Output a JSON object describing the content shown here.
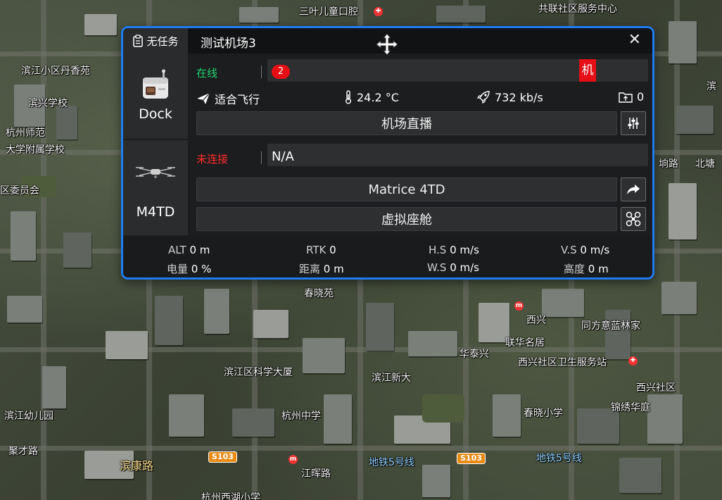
{
  "panel": {
    "task_status": "无任务",
    "title": "测试机场3"
  },
  "dock": {
    "label": "Dock",
    "status": "在线",
    "alert_count": "2",
    "alert_tag": "机",
    "weather": "适合飞行",
    "temperature": "24.2 °C",
    "speed": "732 kb/s",
    "files": "0",
    "live_label": "机场直播"
  },
  "drone": {
    "label": "M4TD",
    "status": "未连接",
    "value": "N/A",
    "model_label": "Matrice 4TD",
    "cockpit_label": "虚拟座舱"
  },
  "telemetry": {
    "alt_label": "ALT",
    "alt": "0 m",
    "rtk_label": "RTK",
    "rtk": "0",
    "hs_label": "H.S",
    "hs": "0 m/s",
    "vs_label": "V.S",
    "vs": "0 m/s",
    "battery_label": "电量",
    "battery": "0 %",
    "distance_label": "距离",
    "distance": "0 m",
    "ws_label": "W.S",
    "ws": "0 m/s",
    "height_label": "高度",
    "height": "0 m"
  },
  "map": {
    "labels": [
      "三叶儿童口腔",
      "共联社区服务中心",
      "滨江小区丹香苑",
      "滨兴学校",
      "杭州师范",
      "大学附属学校",
      "区委员会",
      "垧路",
      "北塘",
      "滨",
      "春晓苑",
      "西兴",
      "同方意蓝林家",
      "联华名居",
      "西兴社区卫生服务站",
      "滨江区科学大厦",
      "滨江新大",
      "华泰兴",
      "杭州中学",
      "滨江幼儿园",
      "春晓小学",
      "西兴社区",
      "锦绣华庭",
      "聚才路",
      "江晖路",
      "杭州西湖小学"
    ],
    "road_labels": [
      "滨康路",
      "地铁5号线",
      "地铁5号线"
    ],
    "shields": [
      "S103",
      "S103"
    ]
  }
}
